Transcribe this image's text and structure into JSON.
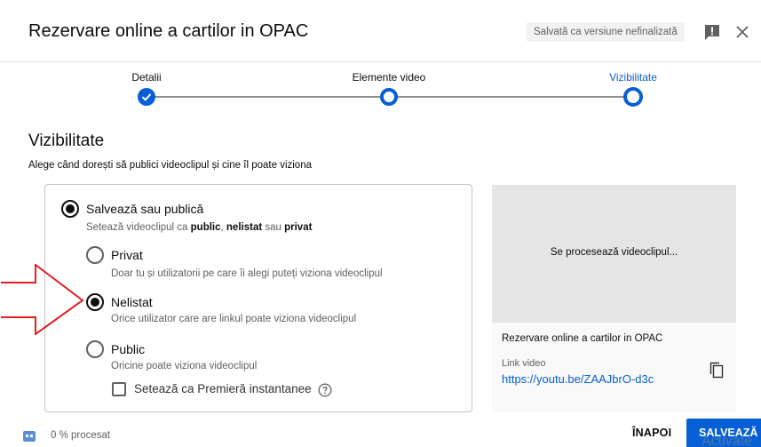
{
  "header": {
    "title": "Rezervare online a cartilor in OPAC",
    "draft_badge": "Salvată ca versiune nefinalizată"
  },
  "stepper": {
    "steps": [
      {
        "label": "Detalii",
        "state": "done"
      },
      {
        "label": "Elemente video",
        "state": "visited"
      },
      {
        "label": "Vizibilitate",
        "state": "current"
      }
    ]
  },
  "visibility": {
    "title": "Vizibilitate",
    "description": "Alege când dorești să publici videoclipul și cine îl poate viziona",
    "save_or_publish": {
      "label": "Salvează sau publică",
      "desc_prefix": "Setează videoclipul ca ",
      "desc_public": "public",
      "desc_sep1": ", ",
      "desc_unlisted": "nelistat",
      "desc_sep2": " sau ",
      "desc_private": "privat",
      "selected": true
    },
    "options": [
      {
        "label": "Privat",
        "desc": "Doar tu și utilizatorii pe care îi alegi puteți viziona videoclipul",
        "selected": false
      },
      {
        "label": "Nelistat",
        "desc": "Orice utilizator care are linkul poate viziona videoclipul",
        "selected": true
      },
      {
        "label": "Public",
        "desc": "Oricine poate viziona videoclipul",
        "selected": false
      }
    ],
    "premiere_label": "Setează ca Premieră instantanee"
  },
  "preview": {
    "processing_text": "Se procesează videoclipul...",
    "video_title": "Rezervare online a cartilor in OPAC",
    "link_label": "Link video",
    "link_url": "https://youtu.be/ZAAJbrO-d3c"
  },
  "footer": {
    "status": "0 % procesat",
    "back_label": "ÎNAPOI",
    "save_label": "SALVEAZĂ",
    "watermark": "Activate"
  },
  "colors": {
    "accent": "#065fd4",
    "arrow": "#e02020"
  }
}
